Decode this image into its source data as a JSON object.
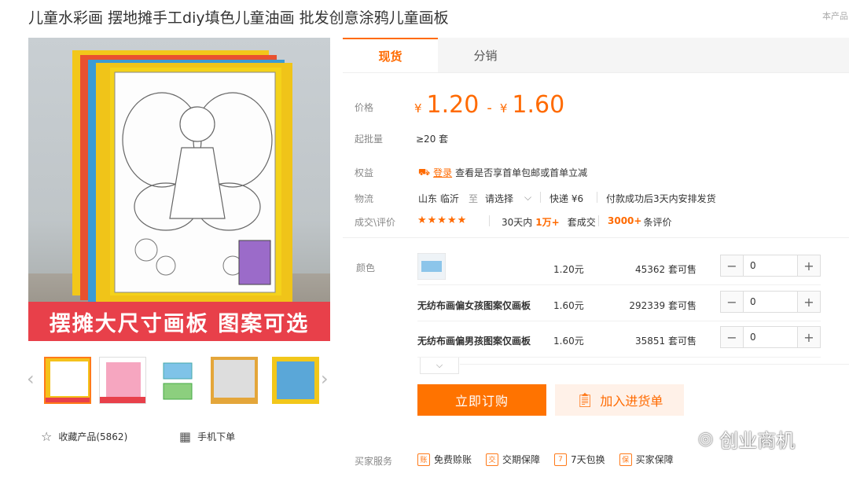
{
  "product": {
    "title": "儿童水彩画 摆地摊手工diy填色儿童油画 批发创意涂鸦儿童画板",
    "corner_note": "本产品"
  },
  "gallery": {
    "banner_text": "摆摊大尺寸画板 图案可选",
    "thumb_count": 5
  },
  "actions": {
    "favorite_label": "收藏产品(5862)",
    "mobile_order_label": "手机下单"
  },
  "tabs": [
    {
      "label": "现货",
      "active": true
    },
    {
      "label": "分销",
      "active": false
    }
  ],
  "pricing": {
    "label": "价格",
    "currency": "¥",
    "min": "1.20",
    "max": "1.60",
    "dash": "-",
    "moq_label": "起批量",
    "moq_value": "≥20 套"
  },
  "benefits": {
    "label": "权益",
    "login_link": "登录",
    "text": "查看是否享首单包邮或首单立减"
  },
  "logistics": {
    "label": "物流",
    "from": "山东 临沂",
    "to_word": "至",
    "select": "请选择",
    "express": "快递 ¥6",
    "ship_note": "付款成功后3天内安排发货"
  },
  "reviews": {
    "label": "成交\\评价",
    "stars": 5,
    "sold_prefix": "30天内",
    "sold_count": "1万+",
    "sold_suffix": "套成交",
    "review_count": "3000+",
    "review_suffix": "条评价"
  },
  "sku": {
    "label": "颜色",
    "rows": [
      {
        "name": "",
        "price": "1.20元",
        "stock": "45362 套可售",
        "qty": "0"
      },
      {
        "name": "无纺布画偏女孩图案仅画板",
        "price": "1.60元",
        "stock": "292339 套可售",
        "qty": "0"
      },
      {
        "name": "无纺布画偏男孩图案仅画板",
        "price": "1.60元",
        "stock": "35851 套可售",
        "qty": "0"
      }
    ]
  },
  "buttons": {
    "buy_now": "立即订购",
    "add_cart": "加入进货单"
  },
  "services": {
    "label": "买家服务",
    "items": [
      {
        "icon": "账",
        "label": "免费赊账"
      },
      {
        "icon": "交",
        "label": "交期保障"
      },
      {
        "icon": "7",
        "label": "7天包换"
      },
      {
        "icon": "保",
        "label": "买家保障"
      }
    ]
  },
  "watermark": "创业商机"
}
